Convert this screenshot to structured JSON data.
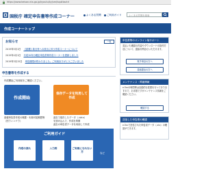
{
  "browser": {
    "url": "https://www.keisan.nta.go.jp/kyoutu/ky/sm/top#bsctrl"
  },
  "header": {
    "site_title": "国税庁 確定申告書等作成コーナー",
    "links": [
      "よくある質問",
      "ご利用ガイド"
    ],
    "search_placeholder": "よくある質問を検索"
  },
  "title_bar": {
    "title": "作成コーナートップ"
  },
  "news": {
    "heading": "お知らせ",
    "list_button": "一覧",
    "items": [
      {
        "date": "2019年5月1日",
        "text": "【重要】新元号への改元に伴う作成コーナーについて"
      },
      {
        "date": "2019年4月1日",
        "text": "平成30年分確定申告書等作成コーナーを更新しました"
      },
      {
        "date": "2019年3月15日",
        "text": "申告期限が終わりました。ご利用ありがとうございました"
      }
    ]
  },
  "section": {
    "heading": "申告書等を作成する",
    "subtitle": "作成開始ご利用前をご確認ください。"
  },
  "banners": {
    "create": "作成開始",
    "saved": "保存データを利用して作成"
  },
  "bullets": {
    "left": [
      "各種申告書作成の概要・利用可能期間等",
      "（別ウィンドウ）"
    ],
    "right": [
      "過去で保存したデータ（.data）",
      "を読み込んで、作成を再開",
      "過去の申告書データを利用して作成"
    ]
  },
  "guide": {
    "title": "ご利用ガイド",
    "boxes": [
      "作成の流れ",
      "入力例",
      "ご利用になれない方"
    ],
    "suffix": "など"
  },
  "sidebar": {
    "panel1": {
      "heading": "申告書等のオンライン版サポート",
      "text": "支払いも確認の内容やダウンロードの操作方法について、直接お問合せいただけます。",
      "buttons": [
        "電子申請の方へ",
        "書面提出の方へ"
      ]
    },
    "panel2": {
      "heading": "メンテナンス・障害情報",
      "text": "e-Taxの時間帯は自動的な変更を行っておりますので、お手数ですがメンテナンス情報をご確認ください。",
      "button": "確認する"
    },
    "panel3": {
      "heading": "送信した申告書の確認",
      "text": "e-Taxで送信された申告書データ（.xtx）の確認ができます。"
    }
  }
}
